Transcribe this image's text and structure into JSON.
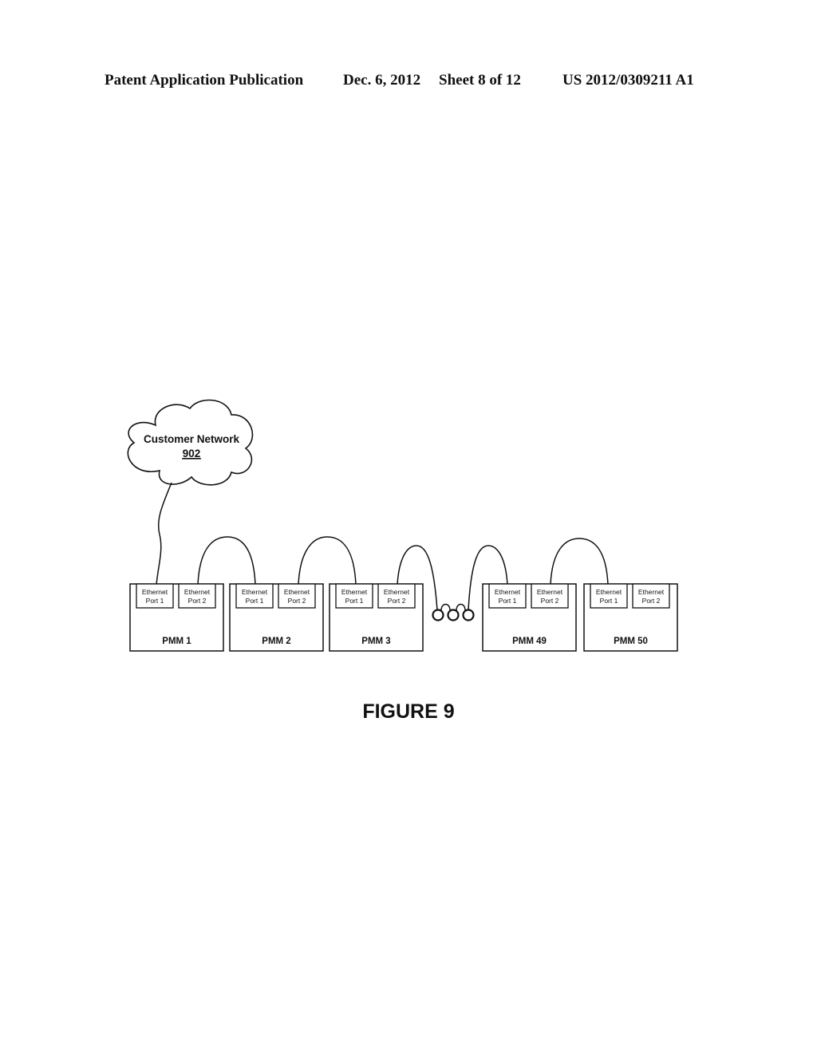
{
  "header": {
    "publication_type": "Patent Application Publication",
    "date": "Dec. 6, 2012",
    "sheet": "Sheet 8 of 12",
    "patent_number": "US 2012/0309211 A1"
  },
  "cloud": {
    "label": "Customer Network",
    "ref": "902"
  },
  "modules": [
    {
      "name": "PMM 1",
      "ports": [
        {
          "line1": "Ethernet",
          "line2": "Port 1"
        },
        {
          "line1": "Ethernet",
          "line2": "Port 2"
        }
      ]
    },
    {
      "name": "PMM 2",
      "ports": [
        {
          "line1": "Ethernet",
          "line2": "Port 1"
        },
        {
          "line1": "Ethernet",
          "line2": "Port 2"
        }
      ]
    },
    {
      "name": "PMM 3",
      "ports": [
        {
          "line1": "Ethernet",
          "line2": "Port 1"
        },
        {
          "line1": "Ethernet",
          "line2": "Port 2"
        }
      ]
    },
    {
      "name": "PMM 49",
      "ports": [
        {
          "line1": "Ethernet",
          "line2": "Port 1"
        },
        {
          "line1": "Ethernet",
          "line2": "Port 2"
        }
      ]
    },
    {
      "name": "PMM 50",
      "ports": [
        {
          "line1": "Ethernet",
          "line2": "Port 1"
        },
        {
          "line1": "Ethernet",
          "line2": "Port 2"
        }
      ]
    }
  ],
  "connections": [
    {
      "from": "Customer Network 902",
      "to": "PMM 1 Ethernet Port 1"
    },
    {
      "from": "PMM 1 Ethernet Port 2",
      "to": "PMM 2 Ethernet Port 1"
    },
    {
      "from": "PMM 2 Ethernet Port 2",
      "to": "PMM 3 Ethernet Port 1"
    },
    {
      "from": "PMM 3 Ethernet Port 2",
      "to": "ellipsis"
    },
    {
      "from": "ellipsis",
      "to": "PMM 49 Ethernet Port 1"
    },
    {
      "from": "PMM 49 Ethernet Port 2",
      "to": "PMM 50 Ethernet Port 1"
    }
  ],
  "ellipsis_symbol": "continuation-loops",
  "figure_title": "FIGURE 9"
}
